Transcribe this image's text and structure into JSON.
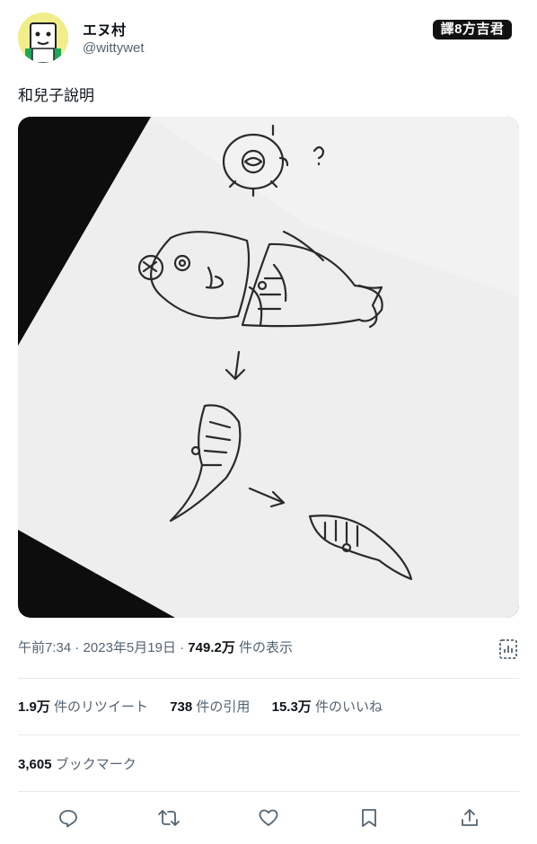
{
  "author": {
    "display_name": "エヌ村",
    "handle": "@wittywet"
  },
  "watermark": "譯8方吉君",
  "tweet": {
    "text": "和兒子說明",
    "meta": {
      "time": "午前7:34",
      "date": "2023年5月19日",
      "views_count": "749.2万",
      "views_label": "件の表示"
    },
    "stats": {
      "retweets_count": "1.9万",
      "retweets_label": "件のリツイート",
      "quotes_count": "738",
      "quotes_label": "件の引用",
      "likes_count": "15.3万",
      "likes_label": "件のいいね"
    },
    "bookmarks": {
      "count": "3,605",
      "label": "ブックマーク"
    }
  },
  "icons": {
    "stats": "view-stats-icon",
    "reply": "reply-icon",
    "retweet": "retweet-icon",
    "like": "heart-icon",
    "bookmark": "bookmark-icon",
    "share": "share-icon"
  },
  "colors": {
    "text": "#0f1419",
    "secondary": "#536471",
    "divider": "#e6e9ec",
    "avatar_bg": "#f1ee8a"
  }
}
